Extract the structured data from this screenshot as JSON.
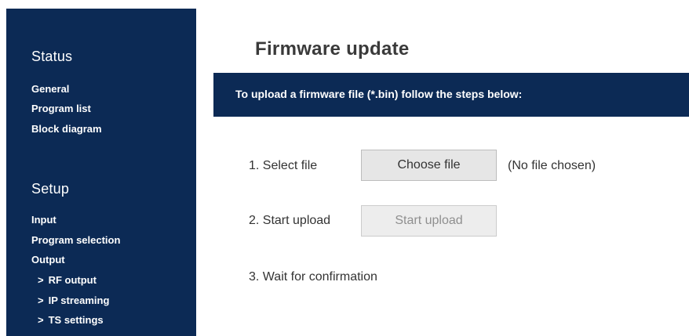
{
  "sidebar": {
    "status_title": "Status",
    "status_items": [
      "General",
      "Program list",
      "Block diagram"
    ],
    "setup_title": "Setup",
    "setup_items": [
      "Input",
      "Program selection",
      "Output"
    ],
    "output_subitems": [
      "RF output",
      "IP streaming",
      "TS settings"
    ],
    "sub_arrow": ">"
  },
  "main": {
    "title": "Firmware update",
    "banner": "To upload a firmware file (*.bin) follow the steps below:",
    "steps": [
      {
        "label": "1. Select file",
        "button": "Choose file",
        "status": "(No file chosen)"
      },
      {
        "label": "2. Start upload",
        "button": "Start upload"
      },
      {
        "label": "3. Wait for confirmation"
      }
    ]
  },
  "colors": {
    "navy": "#0c2a55",
    "button_bg": "#e6e6e6",
    "text": "#333333"
  }
}
